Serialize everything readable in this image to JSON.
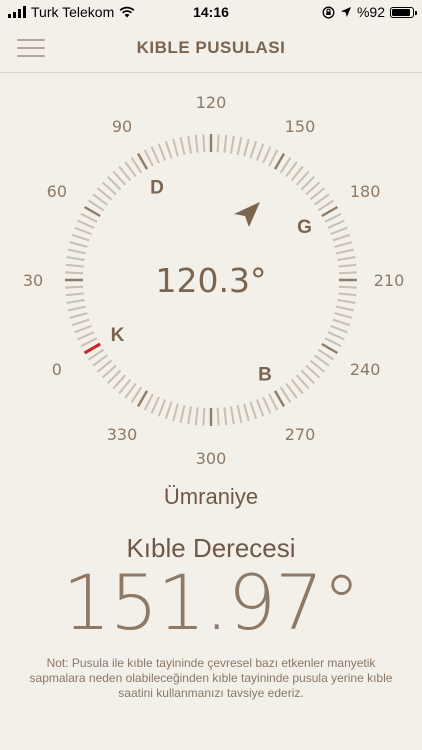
{
  "status_bar": {
    "carrier": "Turk Telekom",
    "time": "14:16",
    "battery": "%92",
    "battery_level": 0.92
  },
  "header": {
    "title": "KIBLE PUSULASI"
  },
  "compass": {
    "heading": "120.3°",
    "heading_value": 120.3,
    "scale_labels": [
      "0",
      "30",
      "60",
      "90",
      "120",
      "150",
      "180",
      "210",
      "240",
      "270",
      "300",
      "330"
    ],
    "direction_letters": [
      "K",
      "D",
      "G",
      "B"
    ],
    "accent_color": "#c62a2a",
    "arrow_color": "#7a6551"
  },
  "location": {
    "city": "Ümraniye"
  },
  "qibla": {
    "label": "Kıble Derecesi",
    "degree": "151.97°"
  },
  "note": "Not: Pusula ile kıble tayininde çevresel bazı etkenler manyetik sapmalara neden olabileceğinden kıble tayininde pusula yerine kıble saatini kullanmanızı tavsiye ederiz."
}
